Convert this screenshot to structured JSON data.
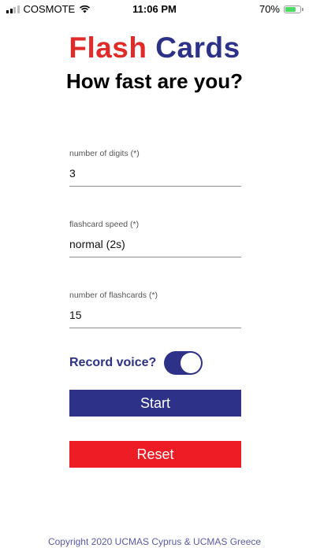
{
  "status_bar": {
    "carrier": "COSMOTE",
    "time": "11:06 PM",
    "battery_percent": "70%",
    "battery_level": 0.7,
    "icons": [
      "signal-icon",
      "wifi-icon",
      "battery-icon"
    ]
  },
  "header": {
    "title_part1": "Flash",
    "title_part2": "Cards",
    "subtitle": "How fast are you?"
  },
  "form": {
    "digits": {
      "label": "number of digits (*)",
      "value": "3"
    },
    "speed": {
      "label": "flashcard speed (*)",
      "value": "normal (2s)"
    },
    "count": {
      "label": "number of flashcards (*)",
      "value": "15"
    },
    "record_voice": {
      "label": "Record voice?",
      "enabled": true
    }
  },
  "buttons": {
    "start": "Start",
    "reset": "Reset"
  },
  "footer": "Copyright 2020 UCMAS Cyprus & UCMAS Greece",
  "colors": {
    "brand_blue": "#2d3187",
    "brand_red": "#e02b2b",
    "reset_red": "#ee1c25",
    "battery_green": "#4cd964"
  }
}
